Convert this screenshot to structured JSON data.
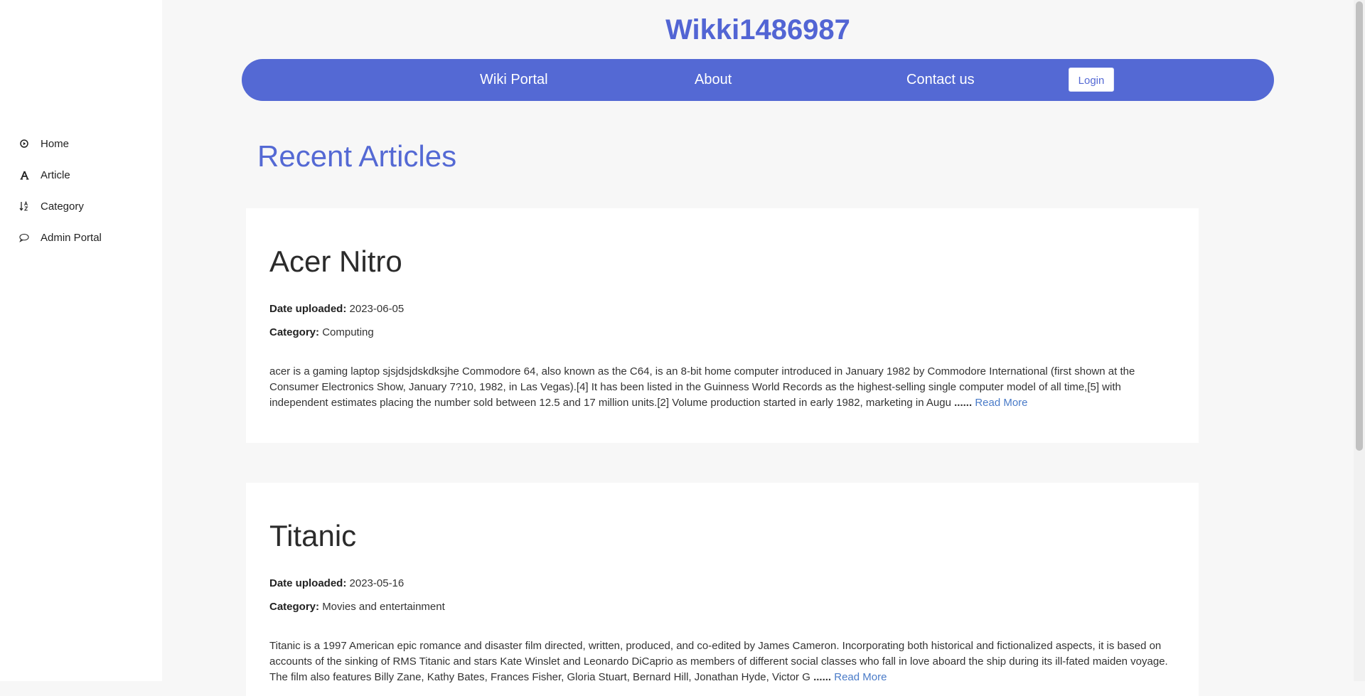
{
  "site": {
    "title": "Wikki1486987"
  },
  "sidebar": {
    "items": [
      {
        "label": "Home",
        "icon": "play-circle-icon"
      },
      {
        "label": "Article",
        "icon": "font-icon"
      },
      {
        "label": "Category",
        "icon": "sort-alpha-icon"
      },
      {
        "label": "Admin Portal",
        "icon": "chat-bubble-icon"
      }
    ]
  },
  "topnav": {
    "links": [
      "Wiki Portal",
      "About",
      "Contact us"
    ],
    "login_label": "Login"
  },
  "main": {
    "heading": "Recent Articles",
    "articles": [
      {
        "title": "Acer Nitro",
        "date_label": "Date uploaded:",
        "date": "2023-06-05",
        "category_label": "Category:",
        "category": "Computing",
        "excerpt": "acer is a gaming laptop sjsjdsjdskdksjhe Commodore 64, also known as the C64, is an 8-bit home computer introduced in January 1982 by Commodore International (first shown at the Consumer Electronics Show, January 7?10, 1982, in Las Vegas).[4] It has been listed in the Guinness World Records as the highest-selling single computer model of all time,[5] with independent estimates placing the number sold between 12.5 and 17 million units.[2] Volume production started in early 1982, marketing in Augu",
        "ellipsis": "......",
        "read_more": "Read More"
      },
      {
        "title": "Titanic",
        "date_label": "Date uploaded:",
        "date": "2023-05-16",
        "category_label": "Category:",
        "category": "Movies and entertainment",
        "excerpt": "Titanic is a 1997 American epic romance and disaster film directed, written, produced, and co-edited by James Cameron. Incorporating both historical and fictionalized aspects, it is based on accounts of the sinking of RMS Titanic and stars Kate Winslet and Leonardo DiCaprio as members of different social classes who fall in love aboard the ship during its ill-fated maiden voyage. The film also features Billy Zane, Kathy Bates, Frances Fisher, Gloria Stuart, Bernard Hill, Jonathan Hyde, Victor G",
        "ellipsis": "......",
        "read_more": "Read More"
      }
    ]
  },
  "colors": {
    "accent": "#5469d4",
    "link": "#4a7bc8"
  }
}
